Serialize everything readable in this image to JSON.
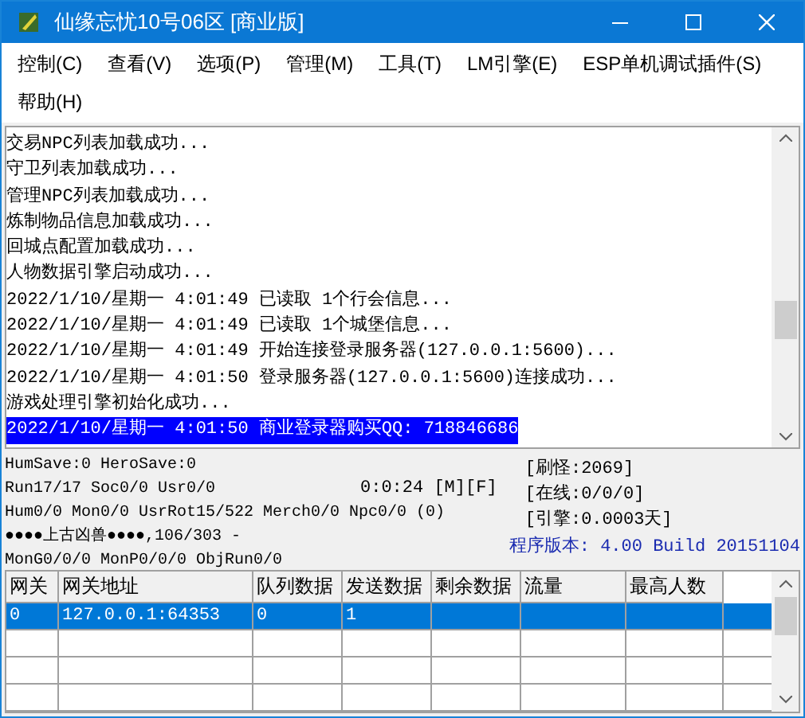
{
  "window": {
    "title": "仙缘忘忧10号06区 [商业版]"
  },
  "menu": [
    {
      "label": "控制(C)"
    },
    {
      "label": "查看(V)"
    },
    {
      "label": "选项(P)"
    },
    {
      "label": "管理(M)"
    },
    {
      "label": "工具(T)"
    },
    {
      "label": "LM引擎(E)"
    },
    {
      "label": "ESP单机调试插件(S)"
    },
    {
      "label": "帮助(H)"
    }
  ],
  "log": [
    {
      "text": "交易NPC列表加载成功...",
      "selected": false
    },
    {
      "text": "守卫列表加载成功...",
      "selected": false
    },
    {
      "text": "管理NPC列表加载成功...",
      "selected": false
    },
    {
      "text": "炼制物品信息加载成功...",
      "selected": false
    },
    {
      "text": "回城点配置加载成功...",
      "selected": false
    },
    {
      "text": "人物数据引擎启动成功...",
      "selected": false
    },
    {
      "text": "2022/1/10/星期一 4:01:49 已读取 1个行会信息...",
      "selected": false
    },
    {
      "text": "2022/1/10/星期一 4:01:49 已读取 1个城堡信息...",
      "selected": false
    },
    {
      "text": "2022/1/10/星期一 4:01:49 开始连接登录服务器(127.0.0.1:5600)...",
      "selected": false
    },
    {
      "text": "2022/1/10/星期一 4:01:50 登录服务器(127.0.0.1:5600)连接成功...",
      "selected": false
    },
    {
      "text": "游戏处理引擎初始化成功...",
      "selected": false
    },
    {
      "text": "2022/1/10/星期一 4:01:50 商业登录器购买QQ: 718846686",
      "selected": true
    }
  ],
  "status": {
    "lines": [
      "HumSave:0 HeroSave:0",
      "Run17/17 Soc0/0 Usr0/0",
      "Hum0/0 Mon0/0 UsrRot15/522 Merch0/0 Npc0/0 (0)",
      "●●●●上古凶兽●●●●,106/303 -",
      "MonG0/0/0 MonP0/0/0 ObjRun0/0"
    ],
    "timer": "0:0:24 [M][F]",
    "counters": [
      "[刷怪:2069]",
      "[在线:0/0/0]",
      "[引擎:0.0003天]"
    ],
    "version": "程序版本: 4.00 Build 20151104"
  },
  "table": {
    "columns": [
      "网关",
      "网关地址",
      "队列数据",
      "发送数据",
      "剩余数据",
      "流量",
      "最高人数"
    ],
    "rows": [
      {
        "cells": [
          "0",
          "127.0.0.1:64353",
          "0",
          "1"
        ],
        "selected": true
      }
    ]
  }
}
